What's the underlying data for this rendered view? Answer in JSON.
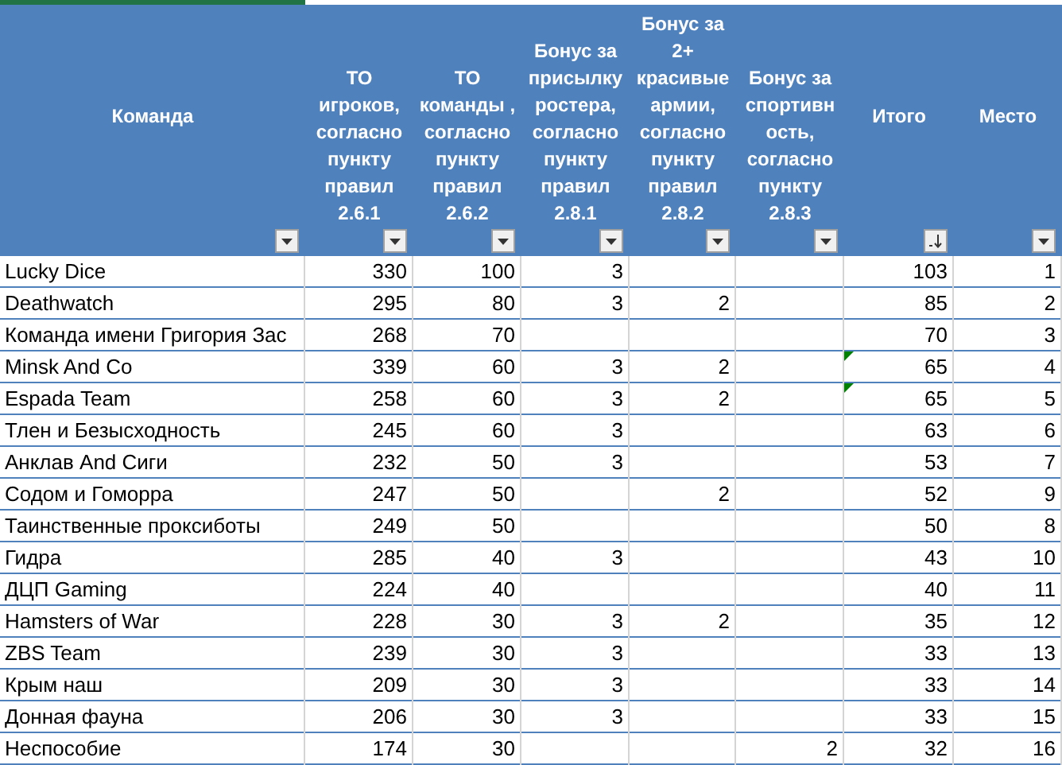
{
  "columns": [
    {
      "label": "Команда",
      "sorted": false
    },
    {
      "label": "ТО игроков, согласно пункту правил 2.6.1",
      "sorted": false
    },
    {
      "label": "ТО команды , согласно пункту правил 2.6.2",
      "sorted": false
    },
    {
      "label": "Бонус за присылку ростера, согласно пункту правил 2.8.1",
      "sorted": false
    },
    {
      "label": "Бонус за 2+ красивые армии, согласно пункту правил 2.8.2",
      "sorted": false
    },
    {
      "label": "Бонус за спортивн ость, согласно пункту 2.8.3",
      "sorted": false
    },
    {
      "label": "Итого",
      "sorted": true
    },
    {
      "label": "Место",
      "sorted": false
    }
  ],
  "rows": [
    {
      "cells": [
        "Lucky Dice",
        "330",
        "100",
        "3",
        null,
        null,
        "103",
        "1"
      ],
      "total_flag": false
    },
    {
      "cells": [
        "Deathwatch",
        "295",
        "80",
        "3",
        "2",
        null,
        "85",
        "2"
      ],
      "total_flag": false
    },
    {
      "cells": [
        "Команда имени Григория Зас",
        "268",
        "70",
        null,
        null,
        null,
        "70",
        "3"
      ],
      "total_flag": false
    },
    {
      "cells": [
        "Minsk And Co",
        "339",
        "60",
        "3",
        "2",
        null,
        "65",
        "4"
      ],
      "total_flag": true
    },
    {
      "cells": [
        "Espada Team",
        "258",
        "60",
        "3",
        "2",
        null,
        "65",
        "5"
      ],
      "total_flag": true
    },
    {
      "cells": [
        "Тлен и Безысходность",
        "245",
        "60",
        "3",
        null,
        null,
        "63",
        "6"
      ],
      "total_flag": false
    },
    {
      "cells": [
        "Анклав And Сиги",
        "232",
        "50",
        "3",
        null,
        null,
        "53",
        "7"
      ],
      "total_flag": false
    },
    {
      "cells": [
        "Содом и Гоморра",
        "247",
        "50",
        null,
        "2",
        null,
        "52",
        "9"
      ],
      "total_flag": false
    },
    {
      "cells": [
        "Таинственные проксиботы",
        "249",
        "50",
        null,
        null,
        null,
        "50",
        "8"
      ],
      "total_flag": false
    },
    {
      "cells": [
        "Гидра",
        "285",
        "40",
        "3",
        null,
        null,
        "43",
        "10"
      ],
      "total_flag": false
    },
    {
      "cells": [
        "ДЦП Gaming",
        "224",
        "40",
        null,
        null,
        null,
        "40",
        "11"
      ],
      "total_flag": false
    },
    {
      "cells": [
        "Hamsters of War",
        "228",
        "30",
        "3",
        "2",
        null,
        "35",
        "12"
      ],
      "total_flag": false
    },
    {
      "cells": [
        "ZBS Team",
        "239",
        "30",
        "3",
        null,
        null,
        "33",
        "13"
      ],
      "total_flag": false
    },
    {
      "cells": [
        "Крым наш",
        "209",
        "30",
        "3",
        null,
        null,
        "33",
        "14"
      ],
      "total_flag": false
    },
    {
      "cells": [
        "Донная фауна",
        "206",
        "30",
        "3",
        null,
        null,
        "33",
        "15"
      ],
      "total_flag": false
    },
    {
      "cells": [
        "Неспособие",
        "174",
        "30",
        null,
        null,
        "2",
        "32",
        "16"
      ],
      "total_flag": false
    }
  ]
}
